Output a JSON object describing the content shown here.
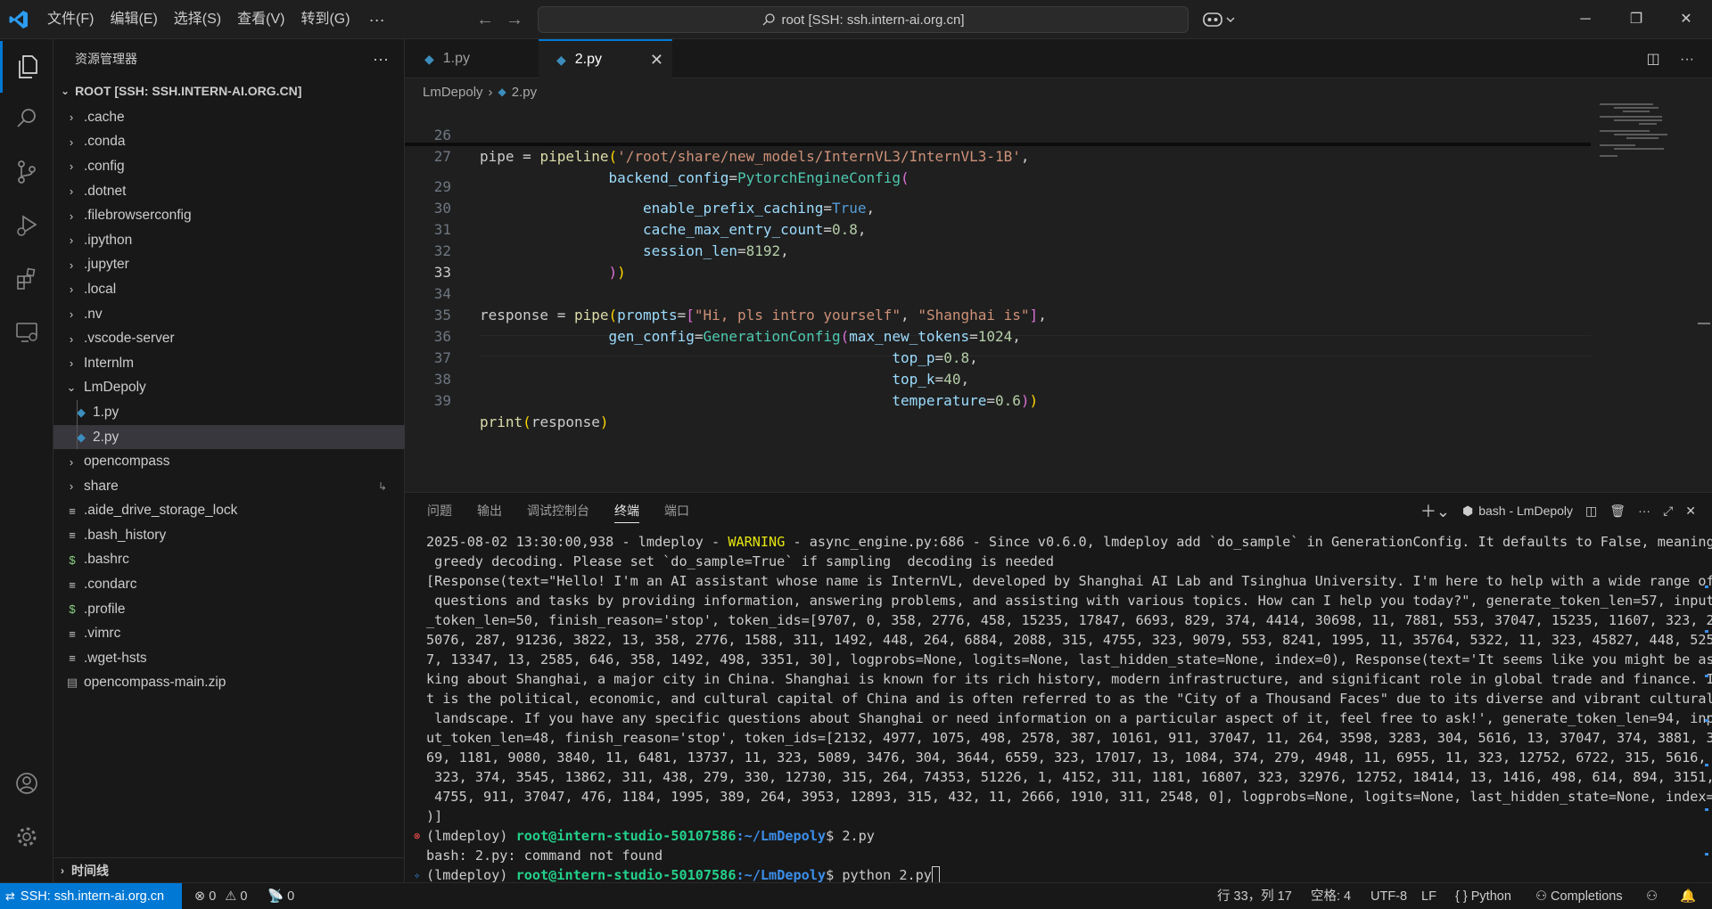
{
  "titlebar": {
    "menu": [
      "文件(F)",
      "编辑(E)",
      "选择(S)",
      "查看(V)",
      "转到(G)"
    ],
    "more": "···",
    "search": "root [SSH: ssh.intern-ai.org.cn]"
  },
  "sidebar": {
    "title": "资源管理器",
    "root": "ROOT [SSH: SSH.INTERN-AI.ORG.CN]",
    "items": [
      {
        "label": ".cache",
        "type": "folder"
      },
      {
        "label": ".conda",
        "type": "folder"
      },
      {
        "label": ".config",
        "type": "folder"
      },
      {
        "label": ".dotnet",
        "type": "folder"
      },
      {
        "label": ".filebrowserconfig",
        "type": "folder"
      },
      {
        "label": ".ipython",
        "type": "folder"
      },
      {
        "label": ".jupyter",
        "type": "folder"
      },
      {
        "label": ".local",
        "type": "folder"
      },
      {
        "label": ".nv",
        "type": "folder"
      },
      {
        "label": ".vscode-server",
        "type": "folder"
      },
      {
        "label": "Internlm",
        "type": "folder"
      },
      {
        "label": "LmDepoly",
        "type": "folder-open"
      },
      {
        "label": "1.py",
        "type": "python"
      },
      {
        "label": "2.py",
        "type": "python"
      },
      {
        "label": "opencompass",
        "type": "folder"
      },
      {
        "label": "share",
        "type": "folder"
      },
      {
        "label": ".aide_drive_storage_lock",
        "type": "file"
      },
      {
        "label": ".bash_history",
        "type": "file"
      },
      {
        "label": ".bashrc",
        "type": "shell"
      },
      {
        "label": ".condarc",
        "type": "file"
      },
      {
        "label": ".profile",
        "type": "shell"
      },
      {
        "label": ".vimrc",
        "type": "file"
      },
      {
        "label": ".wget-hsts",
        "type": "file"
      },
      {
        "label": "opencompass-main.zip",
        "type": "zip"
      }
    ],
    "timeline": "时间线"
  },
  "tabs": [
    {
      "label": "1.py",
      "active": false
    },
    {
      "label": "2.py",
      "active": true
    }
  ],
  "breadcrumb": {
    "folder": "LmDepoly",
    "file": "2.py"
  },
  "editor": {
    "line_numbers": [
      "26",
      "27",
      "29",
      "30",
      "31",
      "32",
      "33",
      "34",
      "35",
      "36",
      "37",
      "38",
      "39"
    ],
    "current_line": "33"
  },
  "panel": {
    "tabs": [
      "问题",
      "输出",
      "调试控制台",
      "终端",
      "端口"
    ],
    "active_tab": "终端",
    "terminal_name": "bash - LmDepoly",
    "terminal": {
      "line1_a": "2025-08-02 13:30:00,938 - lmdeploy - ",
      "line1_warn": "WARNING",
      "line1_b": " - async_engine.py:686 - Since v0.6.0, lmdeploy add `do_sample` in GenerationConfig. It defaults to False, meaning",
      "line2": " greedy decoding. Please set `do_sample=True` if sampling  decoding is needed",
      "output_lines": [
        "[Response(text=\"Hello! I'm an AI assistant whose name is InternVL, developed by Shanghai AI Lab and Tsinghua University. I'm here to help with a wide range of",
        " questions and tasks by providing information, answering problems, and assisting with various topics. How can I help you today?\", generate_token_len=57, input",
        "_token_len=50, finish_reason='stop', token_ids=[9707, 0, 358, 2776, 458, 15235, 17847, 6693, 829, 374, 4414, 30698, 11, 7881, 553, 37047, 15235, 11607, 323, 2",
        "5076, 287, 91236, 3822, 13, 358, 2776, 1588, 311, 1492, 448, 264, 6884, 2088, 315, 4755, 323, 9079, 553, 8241, 1995, 11, 35764, 5322, 11, 323, 45827, 448, 525",
        "7, 13347, 13, 2585, 646, 358, 1492, 498, 3351, 30], logprobs=None, logits=None, last_hidden_state=None, index=0), Response(text='It seems like you might be as",
        "king about Shanghai, a major city in China. Shanghai is known for its rich history, modern infrastructure, and significant role in global trade and finance. I",
        "t is the political, economic, and cultural capital of China and is often referred to as the \"City of a Thousand Faces\" due to its diverse and vibrant cultural",
        " landscape. If you have any specific questions about Shanghai or need information on a particular aspect of it, feel free to ask!', generate_token_len=94, inp",
        "ut_token_len=48, finish_reason='stop', token_ids=[2132, 4977, 1075, 498, 2578, 387, 10161, 911, 37047, 11, 264, 3598, 3283, 304, 5616, 13, 37047, 374, 3881, 3",
        "69, 1181, 9080, 3840, 11, 6481, 13737, 11, 323, 5089, 3476, 304, 3644, 6559, 323, 17017, 13, 1084, 374, 279, 4948, 11, 6955, 11, 323, 12752, 6722, 315, 5616,",
        " 323, 374, 3545, 13862, 311, 438, 279, 330, 12730, 315, 264, 74353, 51226, 1, 4152, 311, 1181, 16807, 323, 32976, 12752, 18414, 13, 1416, 498, 614, 894, 3151,",
        " 4755, 911, 37047, 476, 1184, 1995, 389, 264, 3953, 12893, 315, 432, 11, 2666, 1910, 311, 2548, 0], logprobs=None, logits=None, last_hidden_state=None, index=1",
        ")]"
      ],
      "env": "(lmdeploy) ",
      "user": "root@intern-studio-50107586",
      "path": ":~/LmDepoly",
      "cmd1": "$ 2.py",
      "error": "bash: 2.py: command not found",
      "cmd2": "$ python 2.py"
    }
  },
  "statusbar": {
    "remote": "SSH: ssh.intern-ai.org.cn",
    "errors": "0",
    "warnings": "0",
    "ports": "0",
    "position": "行 33，列 17",
    "spaces": "空格: 4",
    "encoding": "UTF-8",
    "eol": "LF",
    "language": "Python",
    "completions": "Completions"
  }
}
